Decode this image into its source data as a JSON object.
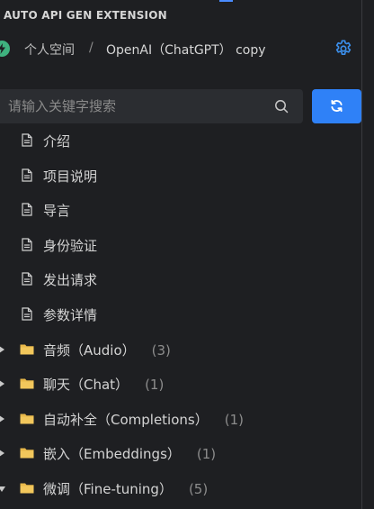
{
  "panel": {
    "title": "AUTO API GEN EXTENSION"
  },
  "breadcrumb": {
    "space": "个人空间",
    "separator": "/",
    "current": "OpenAI（ChatGPT） copy"
  },
  "search": {
    "placeholder": "请输入关键字搜索",
    "value": ""
  },
  "colors": {
    "accent": "#2f81f7",
    "background": "#1e1f22",
    "input_bg": "#2b2d31",
    "folder": "#e8b84a",
    "logo": "#3fb27f"
  },
  "tree": {
    "docs": [
      {
        "label": "介绍",
        "icon": "document-icon"
      },
      {
        "label": "项目说明",
        "icon": "document-icon"
      },
      {
        "label": "导言",
        "icon": "document-icon"
      },
      {
        "label": "身份验证",
        "icon": "document-icon"
      },
      {
        "label": "发出请求",
        "icon": "document-icon"
      },
      {
        "label": "参数详情",
        "icon": "document-icon"
      }
    ],
    "folders": [
      {
        "label": "音频（Audio）",
        "count": "(3)",
        "expanded": false
      },
      {
        "label": "聊天（Chat）",
        "count": "(1)",
        "expanded": false
      },
      {
        "label": "自动补全（Completions）",
        "count": "(1)",
        "expanded": false
      },
      {
        "label": "嵌入（Embeddings）",
        "count": "(1)",
        "expanded": false
      },
      {
        "label": "微调（Fine-tuning）",
        "count": "(5)",
        "expanded": true
      }
    ]
  }
}
